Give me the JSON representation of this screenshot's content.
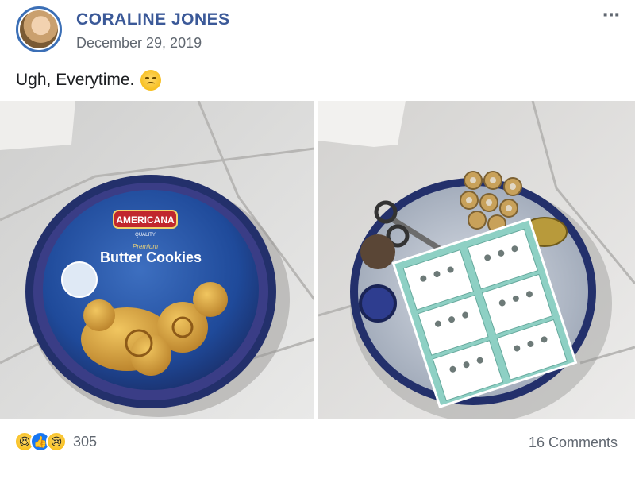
{
  "post": {
    "author": "CORALINE JONES",
    "date": "December 29, 2019",
    "caption": "Ugh, Everytime.",
    "caption_emoji": "unamused-face-icon",
    "more_icon": "⋯"
  },
  "photos": {
    "left": {
      "brand": "AMERICANA",
      "subbrand": "QUALITY",
      "premium": "Premium",
      "product": "Butter Cookies"
    }
  },
  "footer": {
    "reaction_icons": [
      "haha-icon",
      "like-icon",
      "sad-icon"
    ],
    "reaction_count": "305",
    "comments": "16 Comments"
  },
  "colors": {
    "author": "#3b5998",
    "avatar_ring": "#3b6fb6",
    "tin_blue": "#1c3f8a",
    "like": "#1877f2",
    "meta_text": "#606770"
  }
}
